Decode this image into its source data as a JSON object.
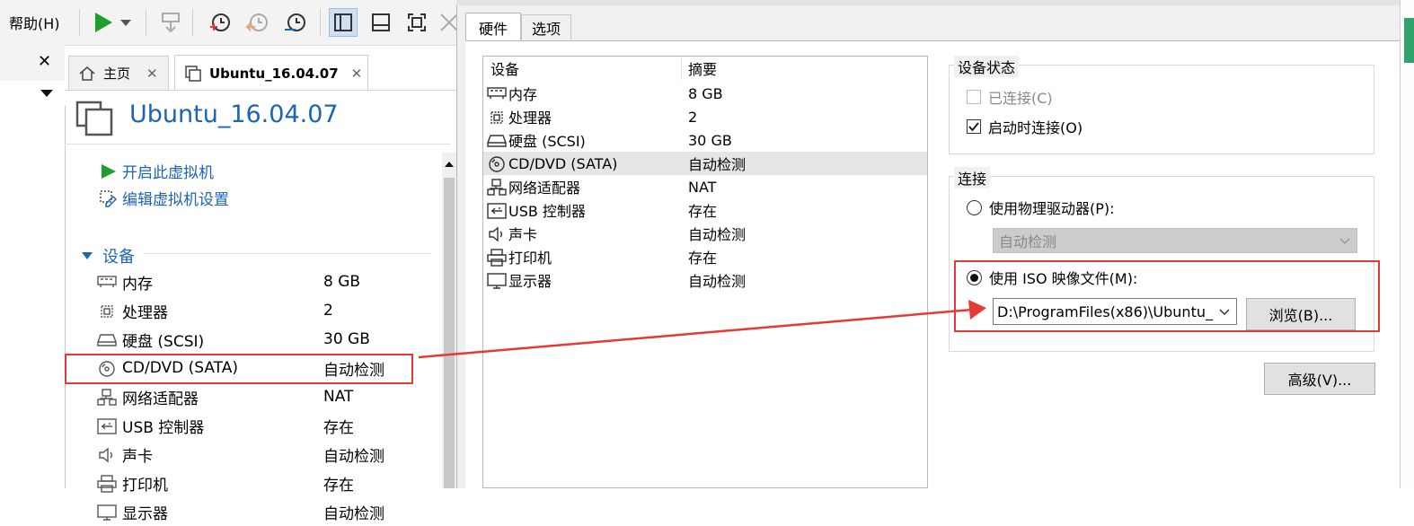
{
  "toolbar": {
    "help_menu": "帮助(H)"
  },
  "tabs": {
    "home": "主页",
    "vm": "Ubuntu_16.04.07"
  },
  "vm": {
    "title": "Ubuntu_16.04.07",
    "power_on": "开启此虚拟机",
    "edit_settings": "编辑虚拟机设置"
  },
  "devices_section": "设备",
  "devices": [
    {
      "icon": "memory-icon",
      "name": "内存",
      "value": "8 GB"
    },
    {
      "icon": "processor-icon",
      "name": "处理器",
      "value": "2"
    },
    {
      "icon": "harddisk-icon",
      "name": "硬盘 (SCSI)",
      "value": "30 GB"
    },
    {
      "icon": "cd-icon",
      "name": "CD/DVD (SATA)",
      "value": "自动检测"
    },
    {
      "icon": "network-icon",
      "name": "网络适配器",
      "value": "NAT"
    },
    {
      "icon": "usb-icon",
      "name": "USB 控制器",
      "value": "存在"
    },
    {
      "icon": "sound-icon",
      "name": "声卡",
      "value": "自动检测"
    },
    {
      "icon": "printer-icon",
      "name": "打印机",
      "value": "存在"
    },
    {
      "icon": "display-icon",
      "name": "显示器",
      "value": "自动检测"
    }
  ],
  "dialog": {
    "tabs": [
      "硬件",
      "选项"
    ],
    "list_headers": {
      "device": "设备",
      "summary": "摘要"
    },
    "device_status": {
      "title": "设备状态",
      "connected": "已连接(C)",
      "connect_on_power": "启动时连接(O)"
    },
    "connection": {
      "title": "连接",
      "physical": "使用物理驱动器(P):",
      "physical_select": "自动检测",
      "iso": "使用 ISO 映像文件(M):",
      "iso_path": "D:\\ProgramFiles(x86)\\Ubuntu_",
      "browse": "浏览(B)..."
    },
    "advanced": "高级(V)..."
  },
  "colors": {
    "accent": "#1c64b4",
    "highlight": "#e53935",
    "play": "#1e9e2b"
  }
}
